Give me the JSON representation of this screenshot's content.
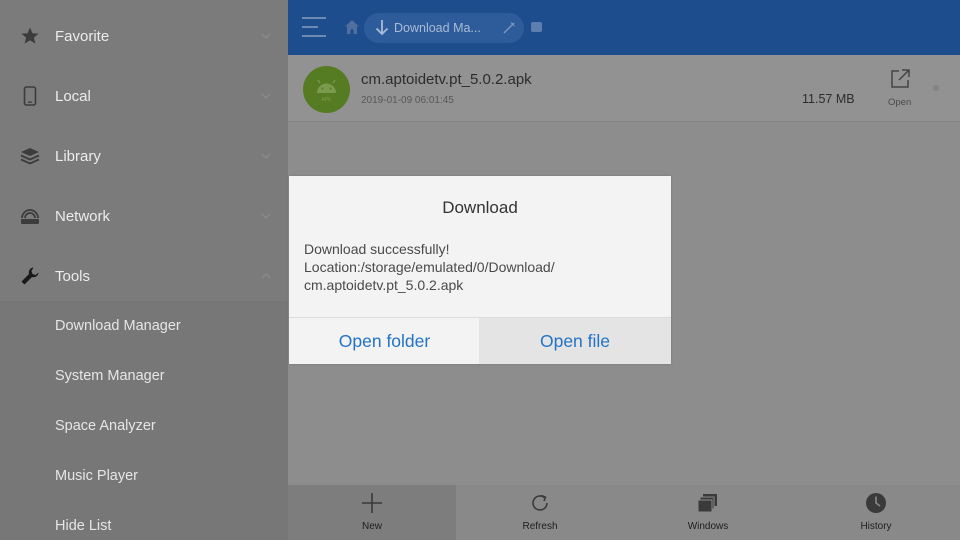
{
  "sidebar": {
    "items": [
      {
        "label": "Favorite",
        "icon": "star-icon"
      },
      {
        "label": "Local",
        "icon": "phone-icon"
      },
      {
        "label": "Library",
        "icon": "library-icon"
      },
      {
        "label": "Network",
        "icon": "network-icon"
      },
      {
        "label": "Tools",
        "icon": "wrench-icon"
      }
    ],
    "tools_submenu": [
      {
        "label": "Download Manager"
      },
      {
        "label": "System Manager"
      },
      {
        "label": "Space Analyzer"
      },
      {
        "label": "Music Player"
      },
      {
        "label": "Hide List"
      }
    ]
  },
  "topbar": {
    "breadcrumb_label": "Download Ma...",
    "icons": [
      "menu-icon",
      "home-icon",
      "download-arrow-icon",
      "edit-icon"
    ]
  },
  "file_list": {
    "items": [
      {
        "name": "cm.aptoidetv.pt_5.0.2.apk",
        "date": "2019-01-09 06:01:45",
        "size": "11.57 MB",
        "action_label": "Open",
        "icon_badge": "APK"
      }
    ]
  },
  "toolbar": {
    "buttons": [
      {
        "label": "New",
        "icon": "plus-icon"
      },
      {
        "label": "Refresh",
        "icon": "refresh-icon"
      },
      {
        "label": "Windows",
        "icon": "windows-icon"
      },
      {
        "label": "History",
        "icon": "history-icon"
      }
    ]
  },
  "dialog": {
    "title": "Download",
    "message": "Download  successfully!\nLocation:/storage/emulated/0/Download/\ncm.aptoidetv.pt_5.0.2.apk",
    "buttons": {
      "open_folder": "Open folder",
      "open_file": "Open file"
    }
  },
  "colors": {
    "topbar": "#1e4d8e",
    "accent_link": "#2273c5",
    "apk_icon": "#567c23"
  }
}
